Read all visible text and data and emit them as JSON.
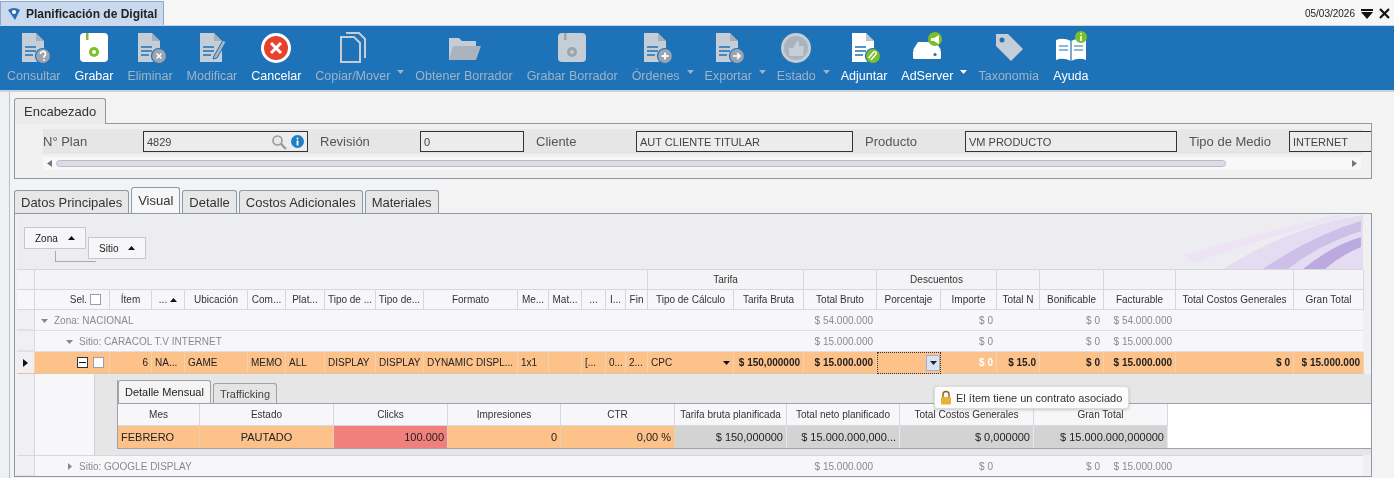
{
  "window": {
    "title": "Planificación de Digital",
    "date": "05/03/2026"
  },
  "toolbar": {
    "items": [
      {
        "label": "Consultar",
        "kind": "query",
        "enabled": false,
        "dropdown": false
      },
      {
        "label": "Grabar",
        "kind": "save",
        "enabled": true,
        "dropdown": false
      },
      {
        "label": "Eliminar",
        "kind": "delete",
        "enabled": false,
        "dropdown": false
      },
      {
        "label": "Modificar",
        "kind": "edit",
        "enabled": false,
        "dropdown": false
      },
      {
        "label": "Cancelar",
        "kind": "cancel",
        "enabled": true,
        "dropdown": false
      },
      {
        "label": "Copiar/Mover",
        "kind": "copy",
        "enabled": false,
        "dropdown": true
      },
      {
        "label": "Obtener Borrador",
        "kind": "folder",
        "enabled": false,
        "dropdown": false
      },
      {
        "label": "Grabar Borrador",
        "kind": "save",
        "enabled": false,
        "dropdown": false
      },
      {
        "label": "Órdenes",
        "kind": "orders",
        "enabled": false,
        "dropdown": true
      },
      {
        "label": "Exportar",
        "kind": "export",
        "enabled": false,
        "dropdown": true
      },
      {
        "label": "Estado",
        "kind": "status",
        "enabled": false,
        "dropdown": true
      },
      {
        "label": "Adjuntar",
        "kind": "attach",
        "enabled": true,
        "dropdown": false
      },
      {
        "label": "AdServer",
        "kind": "server",
        "enabled": true,
        "dropdown": true
      },
      {
        "label": "Taxonomia",
        "kind": "tag",
        "enabled": false,
        "dropdown": false
      },
      {
        "label": "Ayuda",
        "kind": "help",
        "enabled": true,
        "dropdown": false
      }
    ]
  },
  "header": {
    "tab": "Encabezado",
    "fields": [
      {
        "label": "N° Plan",
        "value": "4829",
        "kind": "lookup"
      },
      {
        "label": "Revisión",
        "value": "0",
        "kind": "text"
      },
      {
        "label": "Cliente",
        "value": "AUT CLIENTE TITULAR",
        "kind": "text"
      },
      {
        "label": "Producto",
        "value": "VM PRODUCTO",
        "kind": "text"
      },
      {
        "label": "Tipo de Medio",
        "value": "INTERNET",
        "kind": "text"
      }
    ]
  },
  "tabs": [
    {
      "label": "Datos Principales",
      "selected": false
    },
    {
      "label": "Visual",
      "selected": true
    },
    {
      "label": "Detalle",
      "selected": false
    },
    {
      "label": "Costos Adicionales",
      "selected": false
    },
    {
      "label": "Materiales",
      "selected": false
    }
  ],
  "grid": {
    "group_by": [
      {
        "label": "Zona"
      },
      {
        "label": "Sitio"
      }
    ],
    "columns": [
      {
        "label": "Sel.",
        "sorted": false,
        "summed": false,
        "checkbox": {
          "checked": false
        }
      },
      {
        "label": "Ítem",
        "sorted": false,
        "summed": false
      },
      {
        "label": "...",
        "sorted": true,
        "summed": false
      },
      {
        "label": "Ubicación",
        "sorted": false,
        "summed": false
      },
      {
        "label": "Com...",
        "sorted": false,
        "summed": false
      },
      {
        "label": "Plat...",
        "sorted": false,
        "summed": false
      },
      {
        "label": "Tipo de ...",
        "sorted": false,
        "summed": false
      },
      {
        "label": "Tipo de...",
        "sorted": false,
        "summed": false
      },
      {
        "label": "Formato",
        "sorted": false,
        "summed": false
      },
      {
        "label": "Me...",
        "sorted": false,
        "summed": false
      },
      {
        "label": "Mat...",
        "sorted": false,
        "summed": false
      },
      {
        "label": "...",
        "sorted": false,
        "summed": false
      },
      {
        "label": "I...",
        "sorted": false,
        "summed": false
      },
      {
        "label": "Fin",
        "sorted": false,
        "summed": false
      },
      {
        "band": "Tarifa",
        "columns": [
          {
            "label": "Tipo de Cálculo",
            "sorted": false,
            "summed": false
          },
          {
            "label": "Tarifa Bruta",
            "sorted": false,
            "summed": false
          }
        ]
      },
      {
        "label": "Total Bruto",
        "sorted": false,
        "summed": true
      },
      {
        "band": "Descuentos",
        "columns": [
          {
            "label": "Porcentaje",
            "sorted": false,
            "summed": false
          },
          {
            "label": "Importe",
            "sorted": false,
            "summed": true
          }
        ]
      },
      {
        "label": "Total N",
        "sorted": false,
        "summed": false
      },
      {
        "label": "Bonificable",
        "sorted": false,
        "summed": true
      },
      {
        "label": "Facturable",
        "sorted": false,
        "summed": true
      },
      {
        "label": "Total Costos Generales",
        "sorted": false,
        "summed": false
      },
      {
        "label": "Gran Total",
        "sorted": false,
        "summed": false
      }
    ],
    "groups": [
      {
        "label": "Zona: NACIONAL",
        "expanded": true,
        "totals": [
          "$ 54.000.000",
          "$ 0",
          "$ 0",
          "$ 54.000.000"
        ],
        "children": [
          {
            "label": "Sitio: CARACOL T.V INTERNET",
            "expanded": true,
            "totals": [
              "$ 15.000.000",
              "$ 0",
              "$ 0",
              "$ 15.000.000"
            ],
            "rows": [
              {
                "current": true,
                "expanded": true,
                "checked": false,
                "cells": [
                  "6",
                  "NA...",
                  "GAME",
                  "MEMO",
                  "ALL",
                  "DISPLAY",
                  "DISPLAY",
                  "DYNAMIC DISPL...",
                  "1x1",
                  {
                    "kind": "blank"
                  },
                  "[...",
                  "0...",
                  "2...",
                  {
                    "text": "CPC",
                    "kind": "dropdown"
                  },
                  "$ 150,000000",
                  "$ 15.000.000",
                  {
                    "kind": "editor"
                  },
                  {
                    "text": "$ 0",
                    "kind": "faded"
                  },
                  "$ 15.0",
                  "$ 0",
                  "$ 15.000.000",
                  "$ 0",
                  "$ 15.000.000"
                ],
                "detail": {
                  "tabs": [
                    {
                      "label": "Detalle Mensual",
                      "selected": true
                    },
                    {
                      "label": "Trafficking",
                      "selected": false
                    }
                  ],
                  "columns": [
                    "Mes",
                    "Estado",
                    "Clicks",
                    "Impresiones",
                    "CTR",
                    "Tarifa bruta planificada",
                    "Total neto planificado",
                    "Total Costos Generales",
                    "Gran Total"
                  ],
                  "rows": [
                    {
                      "cells": [
                        {
                          "text": "FEBRERO",
                          "kind": "editable"
                        },
                        {
                          "text": "PAUTADO",
                          "kind": "editable"
                        },
                        {
                          "text": "100.000",
                          "kind": "alert"
                        },
                        {
                          "text": "0",
                          "kind": "editable"
                        },
                        {
                          "text": "0,00 %",
                          "kind": "editable"
                        },
                        {
                          "text": "$ 150,000000",
                          "kind": "computed"
                        },
                        {
                          "text": "$ 15.000.000,000...",
                          "kind": "computed"
                        },
                        {
                          "text": "$ 0,000000",
                          "kind": "computed"
                        },
                        {
                          "text": "$ 15.000.000,000000",
                          "kind": "computed"
                        }
                      ]
                    }
                  ]
                }
              }
            ]
          },
          {
            "label": "Sitio: GOOGLE DISPLAY",
            "expanded": false,
            "totals": [
              "$ 15.000.000",
              "$ 0",
              "$ 0",
              "$ 15.000.000"
            ]
          }
        ]
      }
    ]
  },
  "tooltip": {
    "text": "El ítem tiene un contrato asociado"
  }
}
